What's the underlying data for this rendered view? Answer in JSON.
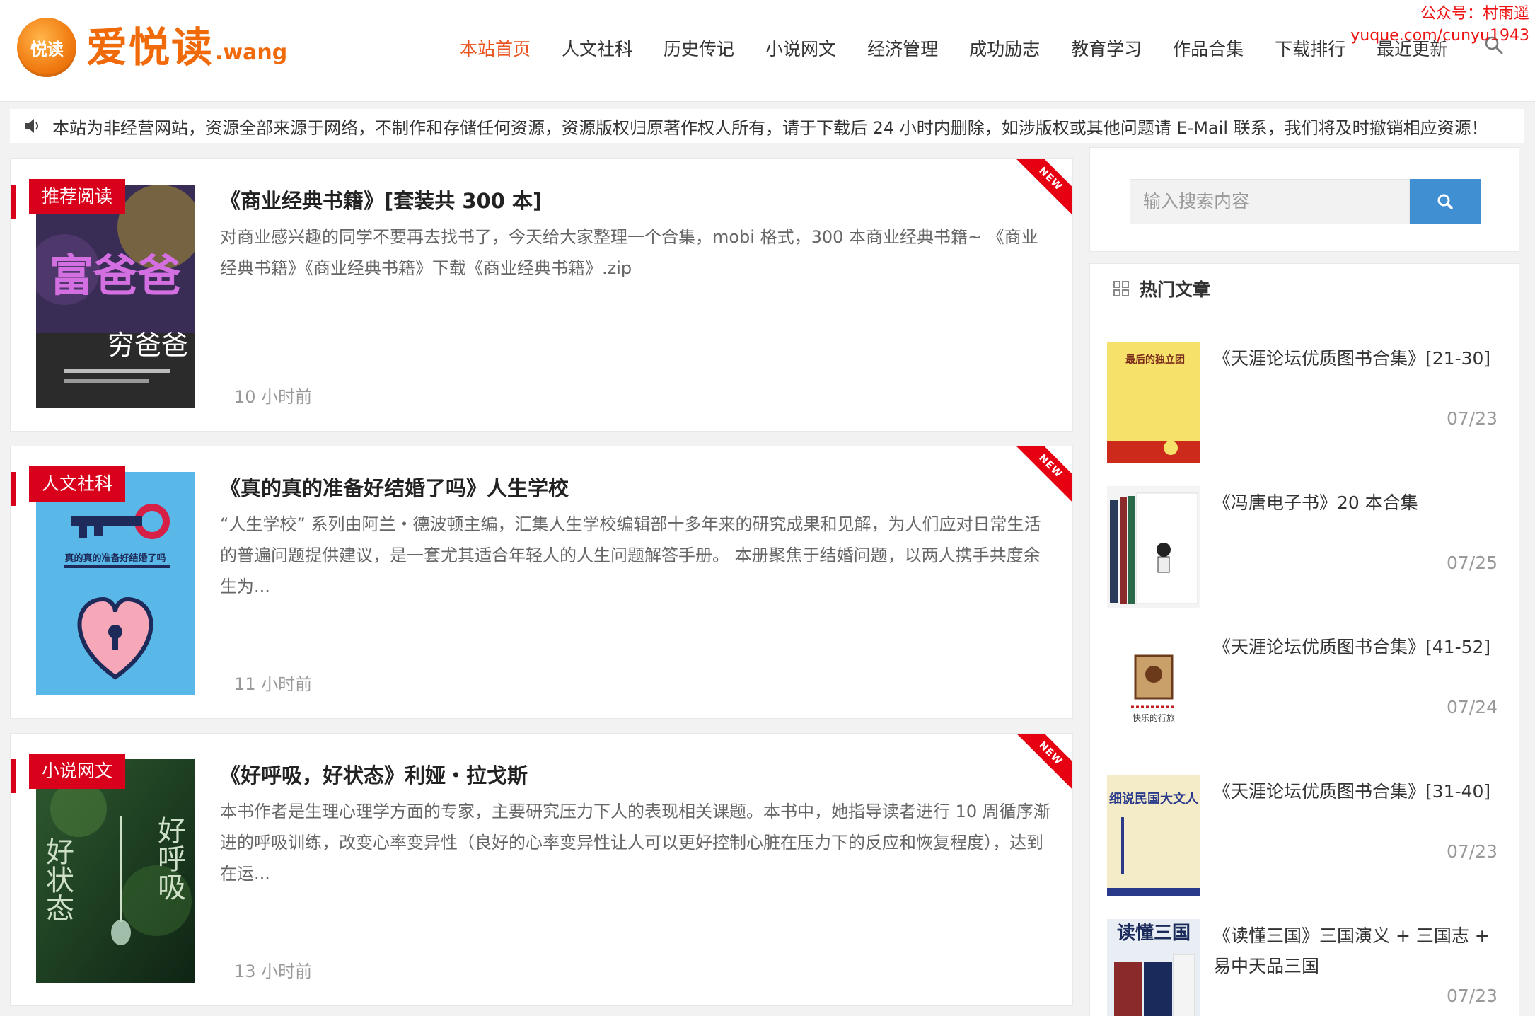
{
  "watermark": {
    "line1": "公众号：村雨遥",
    "line2": "yuque.com/cunyu1943"
  },
  "header": {
    "logo_badge": "悦读",
    "logo_text": "爱悦读",
    "logo_suffix": ".wang",
    "nav": [
      {
        "label": "本站首页",
        "active": true
      },
      {
        "label": "人文社科"
      },
      {
        "label": "历史传记"
      },
      {
        "label": "小说网文"
      },
      {
        "label": "经济管理"
      },
      {
        "label": "成功励志"
      },
      {
        "label": "教育学习"
      },
      {
        "label": "作品合集"
      },
      {
        "label": "下载排行"
      },
      {
        "label": "最近更新"
      }
    ]
  },
  "notice": {
    "text": "本站为非经营网站，资源全部来源于网络，不制作和存储任何资源，资源版权归原著作权人所有，请于下载后 24 小时内删除，如涉版权或其他问题请 E-Mail 联系，我们将及时撤销相应资源！"
  },
  "articles": [
    {
      "category": "推荐阅读",
      "ribbon": "NEW",
      "title": "《商业经典书籍》[套装共 300 本]",
      "excerpt": "对商业感兴趣的同学不要再去找书了，今天给大家整理一个合集，mobi 格式，300 本商业经典书籍~ 《商业经典书籍》《商业经典书籍》下载《商业经典书籍》.zip",
      "time": "10 小时前",
      "cover_text_big": "富爸爸",
      "cover_text_sub": "穷爸爸"
    },
    {
      "category": "人文社科",
      "ribbon": "NEW",
      "title": "《真的真的准备好结婚了吗》人生学校",
      "excerpt": "“人生学校” 系列由阿兰・德波顿主编，汇集人生学校编辑部十多年来的研究成果和见解，为人们应对日常生活的普遍问题提供建议，是一套尤其适合年轻人的人生问题解答手册。 本册聚焦于结婚问题，以两人携手共度余生为...",
      "time": "11 小时前",
      "cover_text_big": "真的真的准备好结婚了吗"
    },
    {
      "category": "小说网文",
      "ribbon": "NEW",
      "title": "《好呼吸，好状态》利娅・拉戈斯",
      "excerpt": "本书作者是生理心理学方面的专家，主要研究压力下人的表现相关课题。本书中，她指导读者进行 10 周循序渐进的呼吸训练，改变心率变异性（良好的心率变异性让人可以更好控制心脏在压力下的反应和恢复程度），达到在运...",
      "time": "13 小时前",
      "cover_text_big": "好状态",
      "cover_text_sub": "好呼吸"
    }
  ],
  "sidebar": {
    "search_placeholder": "输入搜索内容",
    "hot_title": "热门文章",
    "hot_items": [
      {
        "title": "《天涯论坛优质图书合集》[21-30]",
        "date": "07/23",
        "cover_text": "最后的独立团"
      },
      {
        "title": "《冯唐电子书》20 本合集",
        "date": "07/25"
      },
      {
        "title": "《天涯论坛优质图书合集》[41-52]",
        "date": "07/24",
        "cover_text": "快乐的行旅"
      },
      {
        "title": "《天涯论坛优质图书合集》[31-40]",
        "date": "07/23",
        "cover_text": "细说民国大文人"
      },
      {
        "title": "《读懂三国》三国演义 + 三国志 + 易中天品三国",
        "date": "07/23",
        "cover_text": "读懂三国"
      }
    ]
  }
}
